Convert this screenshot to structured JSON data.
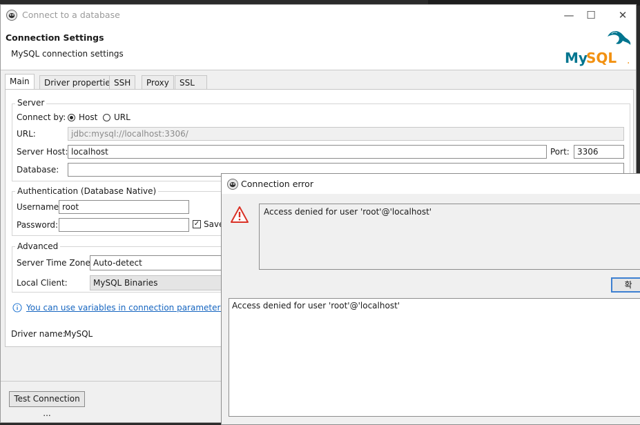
{
  "window": {
    "title": "Connect to a database",
    "minimize": "—",
    "maximize": "☐",
    "close": "✕"
  },
  "header": {
    "title": "Connection Settings",
    "subtitle": "MySQL connection settings",
    "logo_text": "MySQL",
    "logo_dot": "."
  },
  "tabs": [
    {
      "label": "Main",
      "active": true
    },
    {
      "label": "Driver properties"
    },
    {
      "label": "SSH"
    },
    {
      "label": "Proxy"
    },
    {
      "label": "SSL"
    }
  ],
  "server": {
    "group_title": "Server",
    "connect_by_label": "Connect by:",
    "option_host": "Host",
    "option_url": "URL",
    "url_label": "URL:",
    "url_value": "jdbc:mysql://localhost:3306/",
    "host_label": "Server Host:",
    "host_value": "localhost",
    "port_label": "Port:",
    "port_value": "3306",
    "database_label": "Database:",
    "database_value": ""
  },
  "auth": {
    "group_title": "Authentication (Database Native)",
    "username_label": "Username:",
    "username_value": "root",
    "password_label": "Password:",
    "password_value": "",
    "save_label": "Save"
  },
  "advanced": {
    "group_title": "Advanced",
    "timezone_label": "Server Time Zone:",
    "timezone_value": "Auto-detect",
    "client_label": "Local Client:",
    "client_value": "MySQL Binaries"
  },
  "info_link": "You can use variables in connection parameters.",
  "driver": {
    "label": "Driver name:",
    "value": "MySQL"
  },
  "test_button": "Test Connection ...",
  "error_dialog": {
    "title": "Connection error",
    "message": "Access denied for user 'root'@'localhost'",
    "ok_label": "확",
    "detail": "Access denied for user 'root'@'localhost'"
  },
  "colors": {
    "mysql_blue": "#00758f",
    "mysql_orange": "#f29111",
    "warning_red": "#d93025",
    "link_blue": "#1565c0"
  }
}
